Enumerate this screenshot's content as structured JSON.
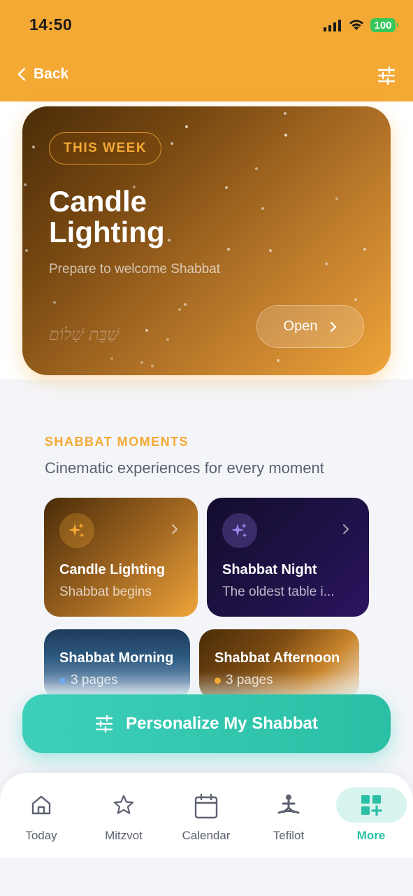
{
  "status_bar": {
    "time": "14:50",
    "battery": "100"
  },
  "nav": {
    "back_label": "Back",
    "filter_icon": "sliders-icon"
  },
  "hero": {
    "badge": "THIS WEEK",
    "title": "Candle Lighting",
    "subtitle": "Prepare to welcome Shabbat",
    "hebrew": "שַׁבָּת שָׁלוֹם",
    "open_label": "Open"
  },
  "moments": {
    "label": "SHABBAT MOMENTS",
    "subtitle": "Cinematic experiences for every moment",
    "cards": [
      {
        "title": "Candle Lighting",
        "desc": "Shabbat begins",
        "icon": "sparkles-icon"
      },
      {
        "title": "Shabbat Night",
        "desc": "The oldest table i...",
        "icon": "sparkles-icon"
      },
      {
        "title": "Shabbat Morning",
        "pages": "3 pages",
        "dot_color": "#6fa8ef"
      },
      {
        "title": "Shabbat Afternoon",
        "pages": "3 pages",
        "dot_color": "#f4a935"
      }
    ]
  },
  "cta": {
    "label": "Personalize My Shabbat"
  },
  "tabs": [
    {
      "label": "Today",
      "icon": "home-icon"
    },
    {
      "label": "Mitzvot",
      "icon": "star-icon"
    },
    {
      "label": "Calendar",
      "icon": "calendar-icon"
    },
    {
      "label": "Tefilot",
      "icon": "prayer-icon"
    },
    {
      "label": "More",
      "icon": "grid-plus-icon",
      "active": true
    }
  ],
  "colors": {
    "accent": "#f4a935",
    "teal": "#2bbfa6",
    "background": "#f4f5f9"
  }
}
